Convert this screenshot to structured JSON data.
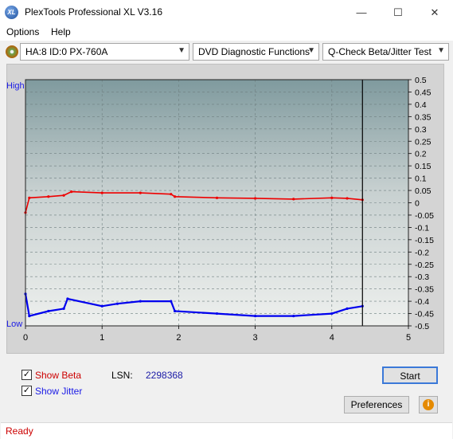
{
  "window": {
    "title": "PlexTools Professional XL V3.16",
    "logo": "XL"
  },
  "menu": {
    "options": "Options",
    "help": "Help"
  },
  "toolbar": {
    "drive": "HA:8 ID:0  PX-760A",
    "function": "DVD Diagnostic Functions",
    "test": "Q-Check Beta/Jitter Test"
  },
  "chart_data": {
    "type": "line",
    "left_labels": {
      "top": "High",
      "bottom": "Low"
    },
    "x_ticks": [
      "0",
      "1",
      "2",
      "3",
      "4",
      "5"
    ],
    "xlim": [
      0,
      5
    ],
    "y_ticks": [
      "0.5",
      "0.45",
      "0.4",
      "0.35",
      "0.3",
      "0.25",
      "0.2",
      "0.15",
      "0.1",
      "0.05",
      "0",
      "-0.05",
      "-0.1",
      "-0.15",
      "-0.2",
      "-0.25",
      "-0.3",
      "-0.35",
      "-0.4",
      "-0.45",
      "-0.5"
    ],
    "ylim": [
      -0.5,
      0.5
    ],
    "grid": true,
    "end_marker_x": 4.4,
    "series": [
      {
        "color": "#ee0000",
        "x": [
          0.0,
          0.05,
          0.3,
          0.5,
          0.6,
          1.0,
          1.5,
          1.9,
          1.95,
          2.5,
          3.0,
          3.5,
          4.0,
          4.2,
          4.4
        ],
        "y": [
          -0.04,
          0.02,
          0.025,
          0.03,
          0.045,
          0.04,
          0.04,
          0.035,
          0.025,
          0.02,
          0.018,
          0.015,
          0.02,
          0.018,
          0.012
        ]
      },
      {
        "color": "#0000ee",
        "x": [
          0.0,
          0.05,
          0.3,
          0.5,
          0.55,
          1.0,
          1.2,
          1.5,
          1.9,
          1.95,
          2.5,
          3.0,
          3.5,
          4.0,
          4.2,
          4.4
        ],
        "y": [
          -0.37,
          -0.46,
          -0.44,
          -0.43,
          -0.39,
          -0.42,
          -0.41,
          -0.4,
          -0.4,
          -0.44,
          -0.45,
          -0.46,
          -0.46,
          -0.45,
          -0.43,
          -0.42
        ]
      }
    ]
  },
  "controls": {
    "show_beta": "Show Beta",
    "show_jitter": "Show Jitter",
    "lsn_label": "LSN:",
    "lsn_value": "2298368",
    "start": "Start",
    "preferences": "Preferences"
  },
  "status": {
    "text": "Ready",
    "color": "#cc0000"
  }
}
